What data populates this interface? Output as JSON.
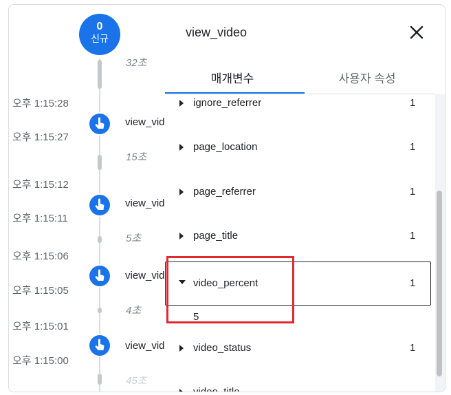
{
  "timeline": {
    "badge_count": "0",
    "badge_label": "신규",
    "durations": [
      "32초",
      "15초",
      "5초",
      "4초",
      "45초"
    ],
    "times": [
      "오후 1:15:28",
      "오후 1:15:27",
      "오후 1:15:12",
      "오후 1:15:11",
      "오후 1:15:06",
      "오후 1:15:05",
      "오후 1:15:01",
      "오후 1:15:00"
    ],
    "events": [
      "view_video",
      "view_video",
      "view_video",
      "view_video"
    ]
  },
  "panel": {
    "title": "view_video",
    "close_icon": "close-icon",
    "tabs": [
      "매개변수",
      "사용자 속성"
    ],
    "active_tab": "매개변수",
    "rows": [
      {
        "key": "ignore_referrer",
        "count": "1"
      },
      {
        "key": "page_location",
        "count": "1"
      },
      {
        "key": "page_referrer",
        "count": "1"
      },
      {
        "key": "page_title",
        "count": "1"
      },
      {
        "key": "video_percent",
        "count": "1",
        "value": "5"
      },
      {
        "key": "video_status",
        "count": "1"
      },
      {
        "key": "video_title",
        "count": ""
      }
    ]
  },
  "colors": {
    "accent": "#1a73e8",
    "highlight": "#e0282e"
  }
}
